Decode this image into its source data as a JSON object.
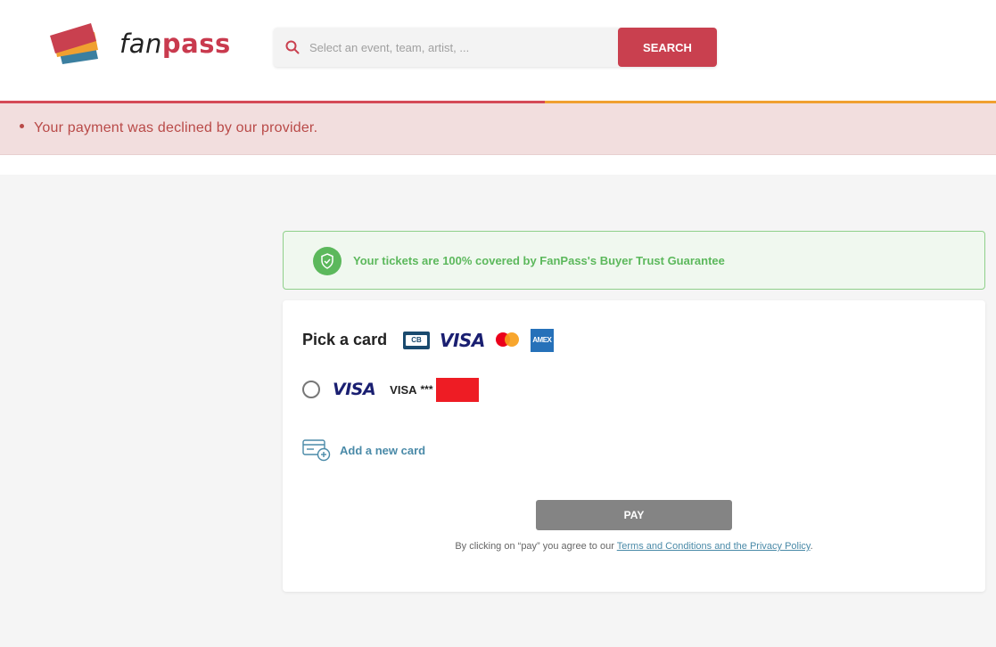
{
  "header": {
    "logo_fan": "fan",
    "logo_pass": "pass",
    "search_placeholder": "Select an event, team, artist, ...",
    "search_value": "",
    "search_button": "SEARCH"
  },
  "alert": {
    "message": "Your payment was declined by our provider."
  },
  "guarantee": {
    "text": "Your tickets are 100% covered by FanPass's Buyer Trust Guarantee"
  },
  "payment": {
    "title": "Pick a card",
    "brands": [
      "cb-icon",
      "visa-icon",
      "mastercard-icon",
      "amex-icon"
    ],
    "brand_text": {
      "cb": "CB",
      "visa": "VISA",
      "amex": "AMEX"
    },
    "saved_card": {
      "brand": "VISA",
      "label": "VISA",
      "mask": "***"
    },
    "add_card_label": "Add a new card",
    "pay_button": "PAY",
    "terms_prefix": "By clicking on “pay” you agree to our ",
    "terms_link": "Terms and Conditions and the Privacy Policy",
    "terms_suffix": "."
  },
  "colors": {
    "brand_red": "#c9404f",
    "progress_orange": "#f0a030",
    "alert_bg": "#f2dede",
    "alert_text": "#b94a48",
    "success_green": "#5cb85c",
    "link_blue": "#4a8aa8",
    "pay_gray": "#848484"
  }
}
